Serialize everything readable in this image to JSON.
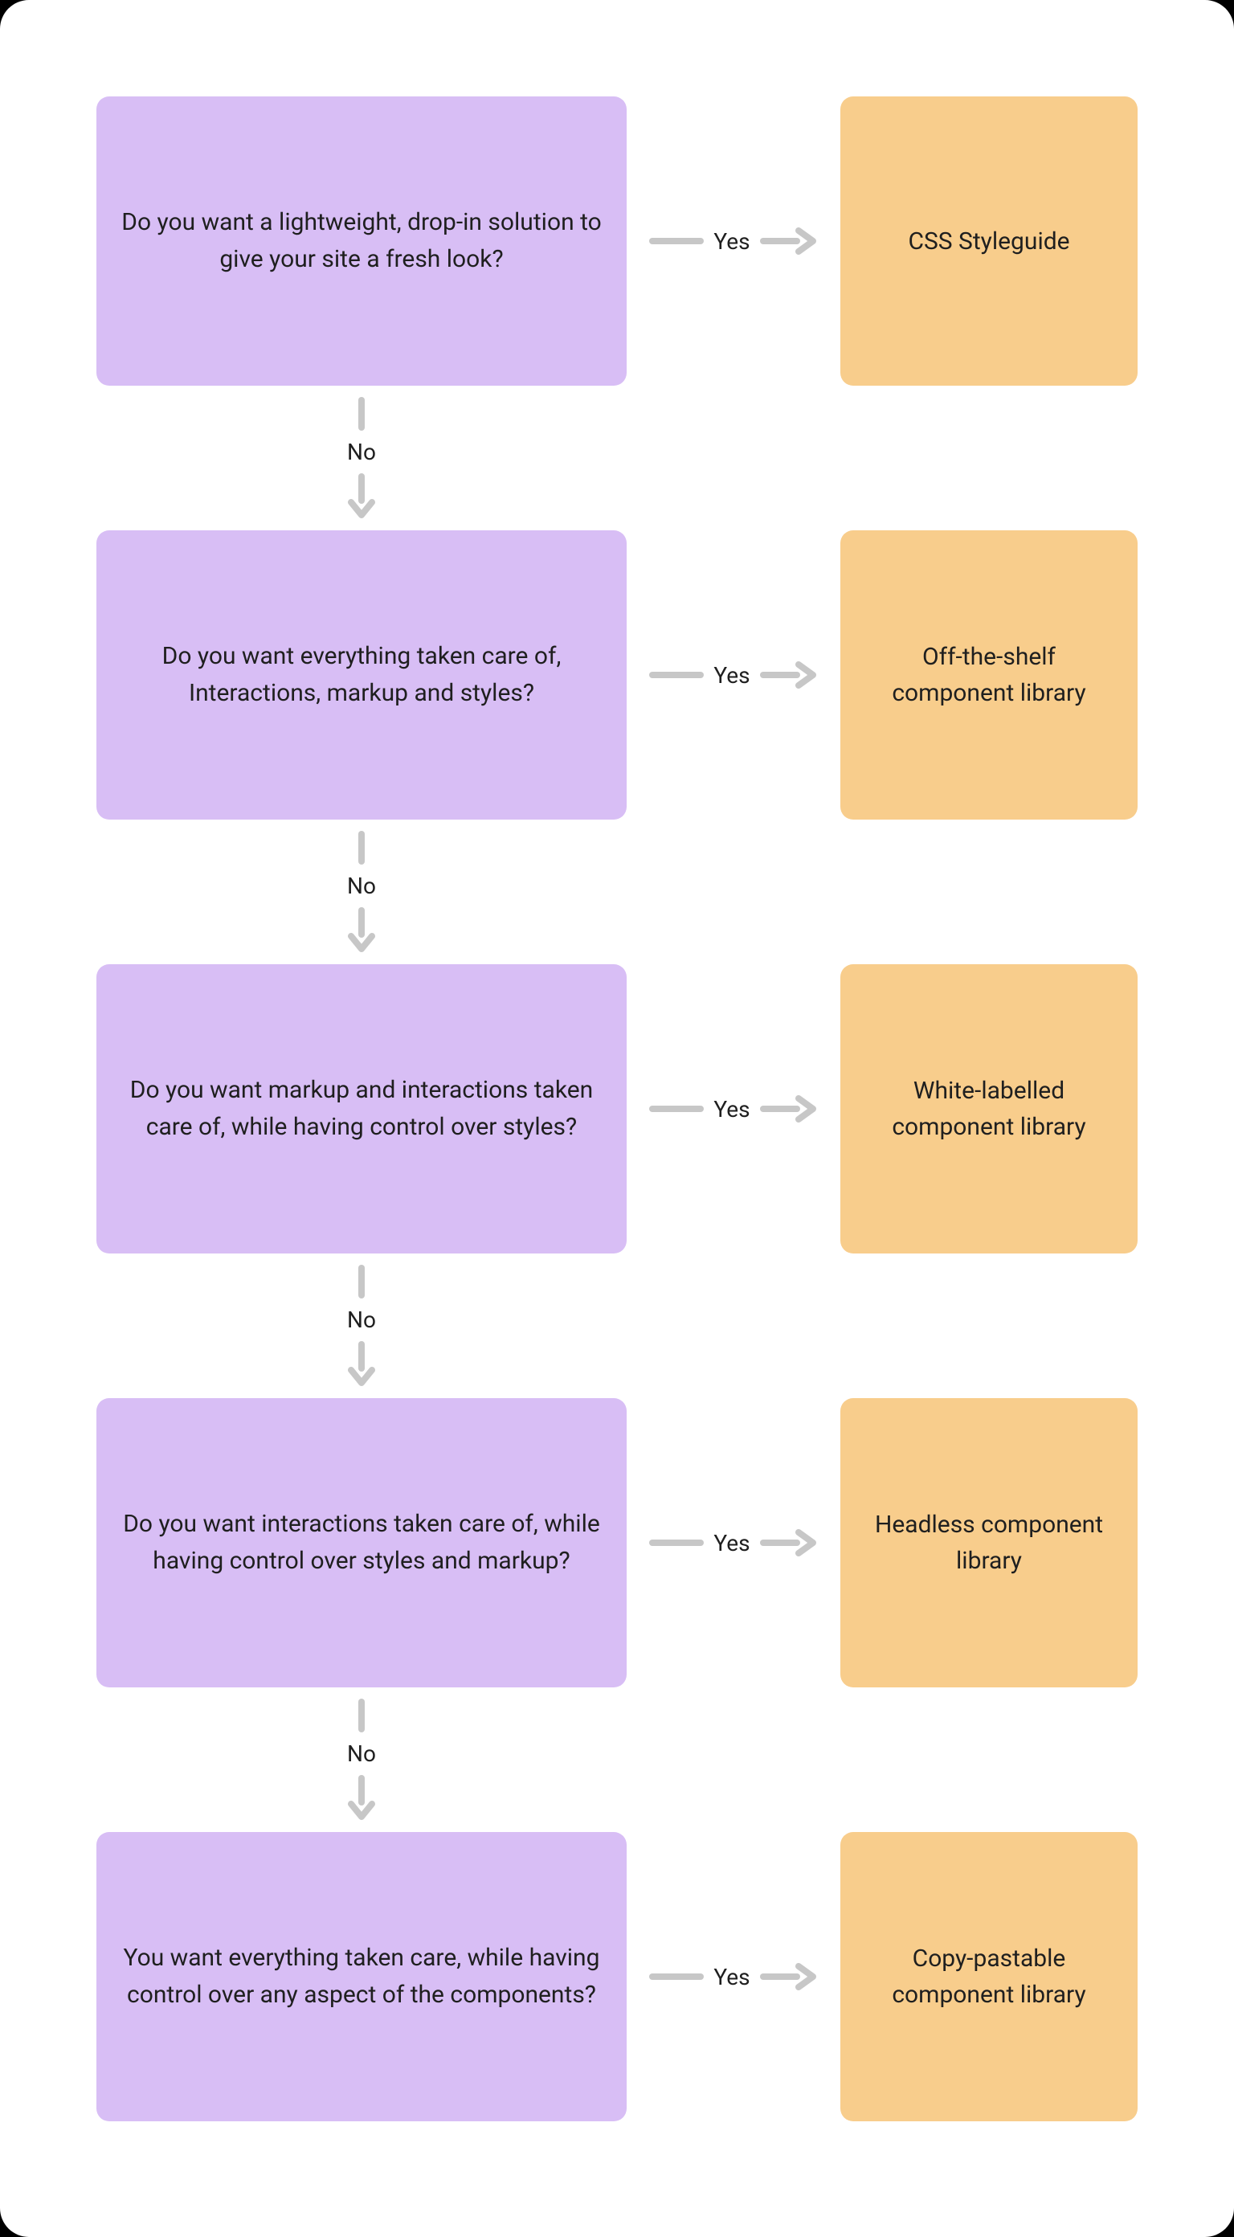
{
  "labels": {
    "yes": "Yes",
    "no": "No"
  },
  "steps": [
    {
      "question": "Do you want a lightweight, drop-in solution to give your site a fresh look?",
      "result": "CSS Styleguide"
    },
    {
      "question": "Do you want everything taken care of, Interactions, markup and styles?",
      "result": "Off-the-shelf component library"
    },
    {
      "question": "Do you want markup and interactions taken care of, while having control over styles?",
      "result": "White-labelled component library"
    },
    {
      "question": "Do you want interactions taken care of, while having control over styles and markup?",
      "result": "Headless component library"
    },
    {
      "question": "You want everything taken care, while having control over any aspect of the components?",
      "result": "Copy-pastable component library"
    }
  ]
}
